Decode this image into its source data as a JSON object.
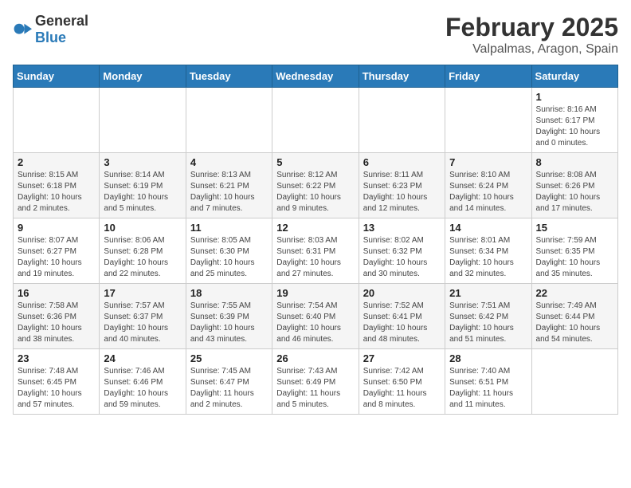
{
  "header": {
    "logo_general": "General",
    "logo_blue": "Blue",
    "month_year": "February 2025",
    "location": "Valpalmas, Aragon, Spain"
  },
  "weekdays": [
    "Sunday",
    "Monday",
    "Tuesday",
    "Wednesday",
    "Thursday",
    "Friday",
    "Saturday"
  ],
  "weeks": [
    [
      {
        "day": "",
        "info": ""
      },
      {
        "day": "",
        "info": ""
      },
      {
        "day": "",
        "info": ""
      },
      {
        "day": "",
        "info": ""
      },
      {
        "day": "",
        "info": ""
      },
      {
        "day": "",
        "info": ""
      },
      {
        "day": "1",
        "info": "Sunrise: 8:16 AM\nSunset: 6:17 PM\nDaylight: 10 hours and 0 minutes."
      }
    ],
    [
      {
        "day": "2",
        "info": "Sunrise: 8:15 AM\nSunset: 6:18 PM\nDaylight: 10 hours and 2 minutes."
      },
      {
        "day": "3",
        "info": "Sunrise: 8:14 AM\nSunset: 6:19 PM\nDaylight: 10 hours and 5 minutes."
      },
      {
        "day": "4",
        "info": "Sunrise: 8:13 AM\nSunset: 6:21 PM\nDaylight: 10 hours and 7 minutes."
      },
      {
        "day": "5",
        "info": "Sunrise: 8:12 AM\nSunset: 6:22 PM\nDaylight: 10 hours and 9 minutes."
      },
      {
        "day": "6",
        "info": "Sunrise: 8:11 AM\nSunset: 6:23 PM\nDaylight: 10 hours and 12 minutes."
      },
      {
        "day": "7",
        "info": "Sunrise: 8:10 AM\nSunset: 6:24 PM\nDaylight: 10 hours and 14 minutes."
      },
      {
        "day": "8",
        "info": "Sunrise: 8:08 AM\nSunset: 6:26 PM\nDaylight: 10 hours and 17 minutes."
      }
    ],
    [
      {
        "day": "9",
        "info": "Sunrise: 8:07 AM\nSunset: 6:27 PM\nDaylight: 10 hours and 19 minutes."
      },
      {
        "day": "10",
        "info": "Sunrise: 8:06 AM\nSunset: 6:28 PM\nDaylight: 10 hours and 22 minutes."
      },
      {
        "day": "11",
        "info": "Sunrise: 8:05 AM\nSunset: 6:30 PM\nDaylight: 10 hours and 25 minutes."
      },
      {
        "day": "12",
        "info": "Sunrise: 8:03 AM\nSunset: 6:31 PM\nDaylight: 10 hours and 27 minutes."
      },
      {
        "day": "13",
        "info": "Sunrise: 8:02 AM\nSunset: 6:32 PM\nDaylight: 10 hours and 30 minutes."
      },
      {
        "day": "14",
        "info": "Sunrise: 8:01 AM\nSunset: 6:34 PM\nDaylight: 10 hours and 32 minutes."
      },
      {
        "day": "15",
        "info": "Sunrise: 7:59 AM\nSunset: 6:35 PM\nDaylight: 10 hours and 35 minutes."
      }
    ],
    [
      {
        "day": "16",
        "info": "Sunrise: 7:58 AM\nSunset: 6:36 PM\nDaylight: 10 hours and 38 minutes."
      },
      {
        "day": "17",
        "info": "Sunrise: 7:57 AM\nSunset: 6:37 PM\nDaylight: 10 hours and 40 minutes."
      },
      {
        "day": "18",
        "info": "Sunrise: 7:55 AM\nSunset: 6:39 PM\nDaylight: 10 hours and 43 minutes."
      },
      {
        "day": "19",
        "info": "Sunrise: 7:54 AM\nSunset: 6:40 PM\nDaylight: 10 hours and 46 minutes."
      },
      {
        "day": "20",
        "info": "Sunrise: 7:52 AM\nSunset: 6:41 PM\nDaylight: 10 hours and 48 minutes."
      },
      {
        "day": "21",
        "info": "Sunrise: 7:51 AM\nSunset: 6:42 PM\nDaylight: 10 hours and 51 minutes."
      },
      {
        "day": "22",
        "info": "Sunrise: 7:49 AM\nSunset: 6:44 PM\nDaylight: 10 hours and 54 minutes."
      }
    ],
    [
      {
        "day": "23",
        "info": "Sunrise: 7:48 AM\nSunset: 6:45 PM\nDaylight: 10 hours and 57 minutes."
      },
      {
        "day": "24",
        "info": "Sunrise: 7:46 AM\nSunset: 6:46 PM\nDaylight: 10 hours and 59 minutes."
      },
      {
        "day": "25",
        "info": "Sunrise: 7:45 AM\nSunset: 6:47 PM\nDaylight: 11 hours and 2 minutes."
      },
      {
        "day": "26",
        "info": "Sunrise: 7:43 AM\nSunset: 6:49 PM\nDaylight: 11 hours and 5 minutes."
      },
      {
        "day": "27",
        "info": "Sunrise: 7:42 AM\nSunset: 6:50 PM\nDaylight: 11 hours and 8 minutes."
      },
      {
        "day": "28",
        "info": "Sunrise: 7:40 AM\nSunset: 6:51 PM\nDaylight: 11 hours and 11 minutes."
      },
      {
        "day": "",
        "info": ""
      }
    ]
  ]
}
